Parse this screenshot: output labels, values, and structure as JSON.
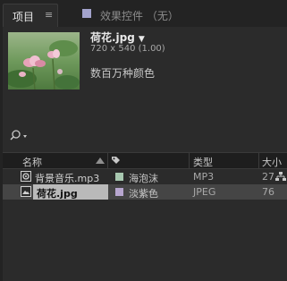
{
  "tabs": {
    "project_label": "项目",
    "menu_glyph": "≡",
    "effects_label": "效果控件 （无）",
    "effects_swatch_color": "#a3a3cc"
  },
  "preview": {
    "file_name": "荷花.jpg",
    "dropdown_glyph": "▼",
    "dimensions": "720 x 540 (1.00)",
    "color_depth": "数百万种颜色"
  },
  "search": {
    "icon": "search-icon",
    "dropdown_glyph": "▾"
  },
  "columns": {
    "name": "名称",
    "label_icon": "tag-icon",
    "type": "类型",
    "size": "大小"
  },
  "rows": [
    {
      "icon": "audio-file-icon",
      "name": "背景音乐.mp3",
      "label_color": "#a8c8b0",
      "label": "海泡沫",
      "type": "MP3",
      "size": "27",
      "selected": false
    },
    {
      "icon": "image-file-icon",
      "name": "荷花.jpg",
      "label_color": "#b7a6cf",
      "label": "淡紫色",
      "type": "JPEG",
      "size": "76",
      "selected": true
    }
  ]
}
